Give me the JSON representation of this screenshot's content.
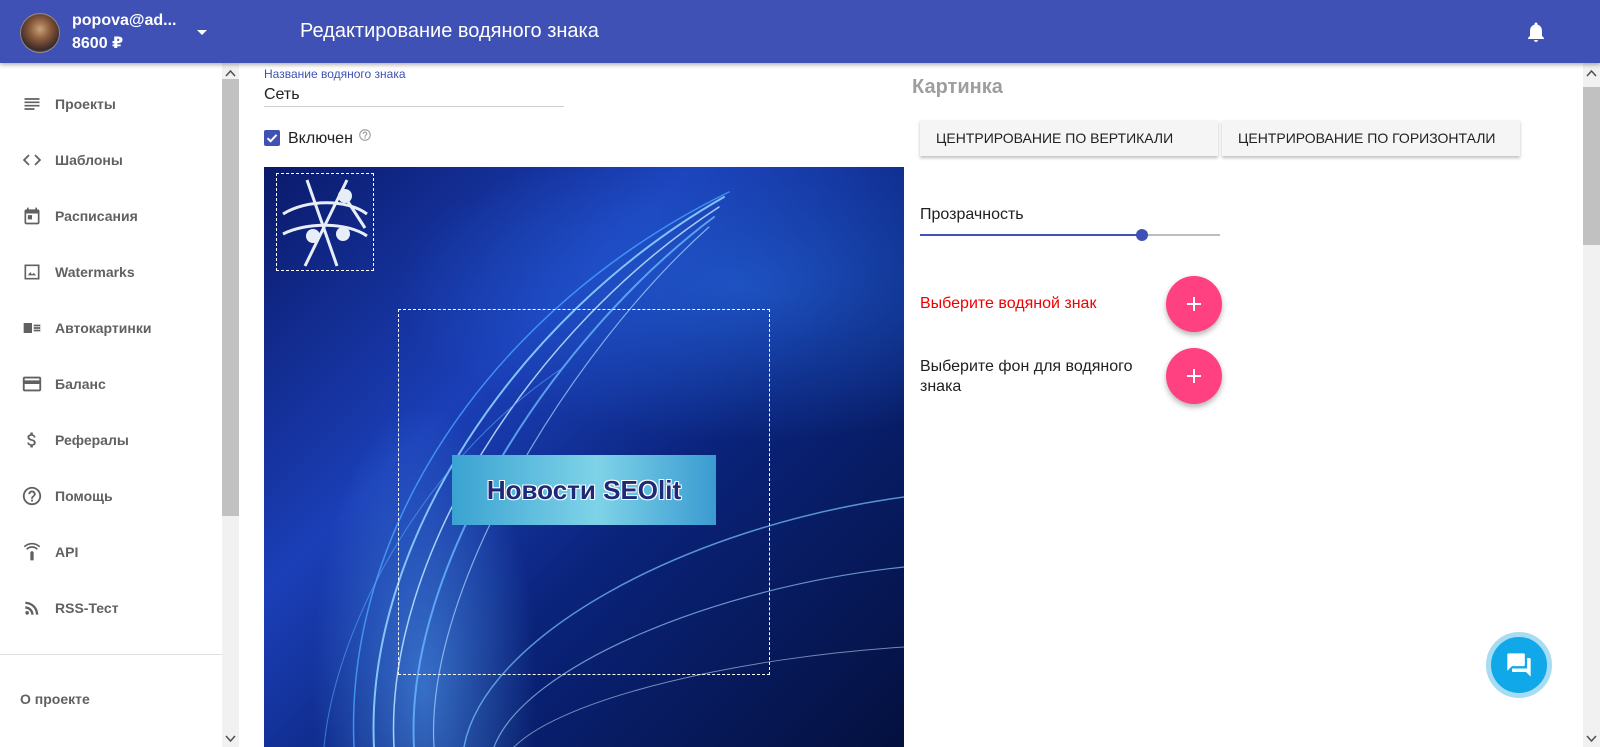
{
  "header": {
    "user_email": "popova@ad...",
    "user_balance": "8600 ₽",
    "page_title": "Редактирование водяного знака",
    "dropdown_icon": "chevron-down-icon",
    "bell_icon": "bell-icon",
    "color": "#3f51b5"
  },
  "sidebar": {
    "items": [
      {
        "label": "Проекты",
        "icon": "list-icon"
      },
      {
        "label": "Шаблоны",
        "icon": "code-icon"
      },
      {
        "label": "Расписания",
        "icon": "calendar-icon"
      },
      {
        "label": "Watermarks",
        "icon": "image-icon"
      },
      {
        "label": "Автокартинки",
        "icon": "auto-image-icon"
      },
      {
        "label": "Баланс",
        "icon": "credit-card-icon"
      },
      {
        "label": "Рефералы",
        "icon": "dollar-icon"
      },
      {
        "label": "Помощь",
        "icon": "help-icon"
      },
      {
        "label": "API",
        "icon": "api-icon"
      },
      {
        "label": "RSS-Тест",
        "icon": "rss-icon"
      }
    ],
    "about_label": "О проекте"
  },
  "form": {
    "name_label": "Название водяного знака",
    "name_value": "Сеть",
    "enabled_label": "Включен",
    "enabled_checked": true
  },
  "preview": {
    "banner_text": "Новости SEOlit"
  },
  "panel": {
    "section_title": "Картинка",
    "center_vertical_label": "ЦЕНТРИРОВАНИЕ ПО ВЕРТИКАЛИ",
    "center_horizontal_label": "ЦЕНТРИРОВАНИЕ ПО ГОРИЗОНТАЛИ",
    "opacity_label": "Прозрачность",
    "opacity_value": 0.74,
    "pick_watermark_label": "Выберите водяной знак",
    "pick_background_label": "Выберите фон для водяного знака",
    "accent_color": "#ff4081",
    "warning_color": "#f00000"
  }
}
